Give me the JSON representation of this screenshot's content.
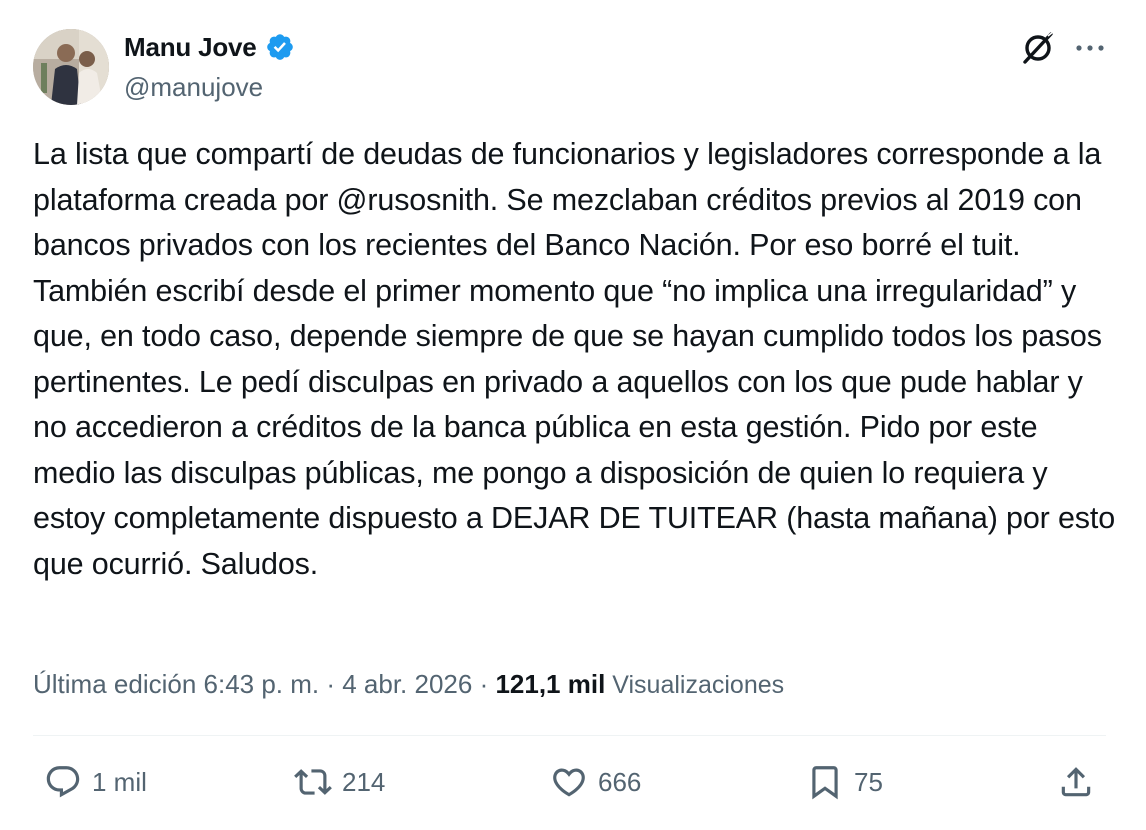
{
  "author": {
    "display_name": "Manu Jove",
    "handle": "@manujove",
    "verified": true,
    "verified_color": "#1d9bf0"
  },
  "header_icons": [
    "grok-icon",
    "more-icon"
  ],
  "tweet": {
    "text": "La lista que compartí de deudas de funcionarios y legisladores corresponde a la plataforma creada por @rusosnith. Se mezclaban créditos previos al 2019 con bancos privados con los recientes del Banco Nación. Por eso borré el tuit. También escribí desde el primer momento que “no implica una irregularidad” y que, en todo caso, depende siempre de que se hayan cumplido todos los pasos pertinentes. Le pedí disculpas en privado a aquellos con los que pude hablar y no accedieron a créditos de la banca pública en esta gestión. Pido por este medio las disculpas públicas, me pongo a disposición de quien lo requiera y estoy completamente dispuesto a DEJAR DE TUITEAR (hasta mañana) por esto que ocurrió. Saludos."
  },
  "meta": {
    "edited_time": "Última edición 6:43 p. m. · 4 abr. 2026 · ",
    "views_count": "121,1 mil",
    "views_label": " Visualizaciones"
  },
  "actions": {
    "reply": "1 mil",
    "retweet": "214",
    "like": "666",
    "bookmark": "75"
  },
  "colors": {
    "text": "#0f1419",
    "secondary": "#536471",
    "divider": "#eff3f4"
  }
}
